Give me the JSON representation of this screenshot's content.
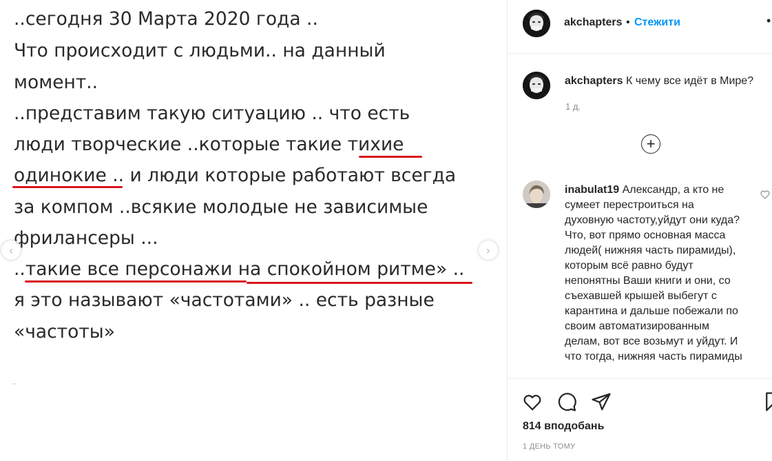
{
  "post_image": {
    "lines": [
      "..сегодня 30 Марта 2020 года ..",
      "Что происходит с людьми.. на данный",
      "момент..",
      "..представим такую ситуацию .. что есть",
      "люди творческие ..которые такие тихие",
      "одинокие .. и люди которые работают всегда",
      "за компом ..всякие молодые не зависимые",
      "фрилансеры ...",
      "..такие все персонажи на спокойном ритме» ..",
      "я это называют «частотами» .. есть разные",
      "«частоты»"
    ],
    "underline_color": "#d9141d",
    "prev_icon": "chevron-left-icon",
    "next_icon": "chevron-right-icon"
  },
  "header": {
    "username": "akchapters",
    "separator": "•",
    "follow_label": "Стежити",
    "more_icon": "more-options-icon"
  },
  "caption": {
    "username": "akchapters",
    "text": "К чему все идёт в Мире?",
    "time": "1 д."
  },
  "load_more_icon": "plus-circle-icon",
  "comments": [
    {
      "username": "inabulat19",
      "text": "Александр, а кто не сумеет перестроиться на духовную частоту,уйдут они куда? Что, вот прямо основная масса людей( нижняя часть пирамиды), которым всё равно будут непонятны Ваши книги и они, со съехавшей крышей выбегут с карантина и дальше побежали по своим автоматизированным делам, вот все возьмут и уйдут. И что тогда, нижняя часть пирамиды"
    }
  ],
  "actions": {
    "like_icon": "heart-icon",
    "comment_icon": "comment-icon",
    "share_icon": "send-icon",
    "save_icon": "bookmark-icon",
    "likes": "814 вподобань",
    "date": "1 ДЕНЬ ТОМУ"
  },
  "colors": {
    "accent": "#0095f6",
    "text": "#262626",
    "secondary": "#8e8e8e"
  }
}
